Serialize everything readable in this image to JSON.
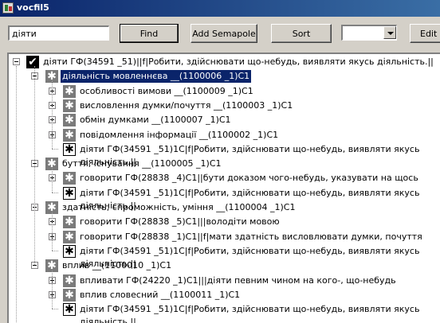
{
  "window": {
    "title": "vocfil5"
  },
  "toolbar": {
    "search_value": "діяти",
    "find_label": "Find",
    "add_semapole_label": "Add Semapole",
    "sort_label": "Sort",
    "combo_value": "",
    "edit_label": "Edit"
  },
  "tree": {
    "root": {
      "label": "діяти ГФ(34591 _51)||f|Робити, здійснювати що-небудь, виявляти якусь діяльність.||"
    },
    "groups": [
      {
        "label": "діяльність мовленнєва __(1100006 _1)C1",
        "selected": true,
        "children": [
          {
            "label": "особливості вимови __(1100009 _1)C1",
            "icon": "star-grey",
            "expandable": true
          },
          {
            "label": "висловлення думки/почуття __(1100003 _1)C1",
            "icon": "star-grey",
            "expandable": true
          },
          {
            "label": "обмін думками __(1100007 _1)C1",
            "icon": "star-grey",
            "expandable": true
          },
          {
            "label": "повідомлення інформації __(1100002 _1)C1",
            "icon": "star-grey",
            "expandable": true
          },
          {
            "label": "діяти ГФ(34591 _51)1C|f|Робити, здійснювати що-небудь, виявляти якусь діяльність.||",
            "icon": "star-white",
            "expandable": false
          }
        ]
      },
      {
        "label": "буття, існування __(1100005 _1)C1",
        "selected": false,
        "children": [
          {
            "label": "говорити ГФ(28838 _4)C1||бути доказом чого-небудь, указувати на щось",
            "icon": "star-grey",
            "expandable": true
          },
          {
            "label": "діяти ГФ(34591 _51)1C|f|Робити, здійснювати що-небудь, виявляти якусь діяльність.||",
            "icon": "star-white",
            "expandable": false
          }
        ]
      },
      {
        "label": "здатність, спроможність, уміння __(1100004 _1)C1",
        "selected": false,
        "children": [
          {
            "label": "говорити ГФ(28838 _5)C1|||володіти мовою",
            "icon": "star-grey",
            "expandable": true
          },
          {
            "label": "говорити ГФ(28838 _1)C1||f|мати здатність висловлювати думки, почуття",
            "icon": "star-grey",
            "expandable": true
          },
          {
            "label": "діяти ГФ(34591 _51)1C|f|Робити, здійснювати що-небудь, виявляти якусь діяльність.||",
            "icon": "star-white",
            "expandable": false
          }
        ]
      },
      {
        "label": "вплив __(1100010 _1)C1",
        "selected": false,
        "children": [
          {
            "label": "впливати ГФ(24220 _1)C1|||діяти певним чином на кого-, що-небудь",
            "icon": "star-grey",
            "expandable": true
          },
          {
            "label": "вплив словесний __(1100011 _1)C1",
            "icon": "star-grey",
            "expandable": true
          },
          {
            "label": "діяти ГФ(34591 _51)1C|f|Робити, здійснювати що-небудь, виявляти якусь діяльність.||",
            "icon": "star-white",
            "expandable": false
          }
        ]
      }
    ]
  }
}
